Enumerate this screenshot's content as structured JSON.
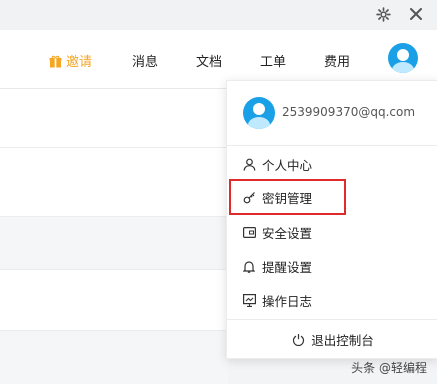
{
  "window": {
    "settings_icon": "gear-icon",
    "close_icon": "close-icon"
  },
  "header": {
    "invite": "邀请",
    "messages": "消息",
    "docs": "文档",
    "tickets": "工单",
    "billing": "费用"
  },
  "dropdown": {
    "email": "2539909370@qq.com",
    "items": [
      {
        "label": "个人中心",
        "icon": "user-icon"
      },
      {
        "label": "密钥管理",
        "icon": "key-icon"
      },
      {
        "label": "安全设置",
        "icon": "card-icon"
      },
      {
        "label": "提醒设置",
        "icon": "bell-icon"
      },
      {
        "label": "操作日志",
        "icon": "log-icon"
      }
    ],
    "logout": "退出控制台"
  },
  "colors": {
    "accent": "#1aa0e6",
    "invite": "#f5a623",
    "highlight_border": "#e12b2b"
  },
  "watermark": "头条 @轻编程"
}
